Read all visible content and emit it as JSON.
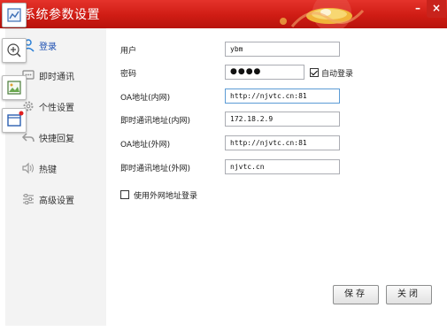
{
  "window": {
    "title": "系统参数设置",
    "minimize_label": "–",
    "close_label": "×"
  },
  "sidebar": {
    "items": [
      {
        "label": "登录",
        "icon": "login-icon",
        "active": true
      },
      {
        "label": "即时通讯",
        "icon": "chat-icon",
        "active": false
      },
      {
        "label": "个性设置",
        "icon": "gear-icon",
        "active": false
      },
      {
        "label": "快捷回复",
        "icon": "reply-icon",
        "active": false
      },
      {
        "label": "热键",
        "icon": "speaker-icon",
        "active": false
      },
      {
        "label": "高级设置",
        "icon": "sliders-icon",
        "active": false
      }
    ]
  },
  "tools": {
    "items": [
      "chart-icon",
      "zoom-in-icon",
      "image-icon",
      "window-icon"
    ]
  },
  "form": {
    "user": {
      "label": "用户",
      "value": "ybm"
    },
    "password": {
      "label": "密码",
      "value": "●●●●"
    },
    "auto_login": {
      "label": "自动登录",
      "checked": true
    },
    "oa_internal": {
      "label": "OA地址(内网)",
      "value": "http://njvtc.cn:81"
    },
    "im_internal": {
      "label": "即时通讯地址(内网)",
      "value": "172.18.2.9"
    },
    "oa_external": {
      "label": "OA地址(外网)",
      "value": "http://njvtc.cn:81"
    },
    "im_external": {
      "label": "即时通讯地址(外网)",
      "value": "njvtc.cn"
    },
    "use_external": {
      "label": "使用外网地址登录",
      "checked": false
    }
  },
  "buttons": {
    "save": "保存",
    "close": "关闭"
  },
  "colors": {
    "titlebar": "#cf1c14",
    "active_nav": "#1c4fb2",
    "focus_border": "#5b9bd5"
  }
}
